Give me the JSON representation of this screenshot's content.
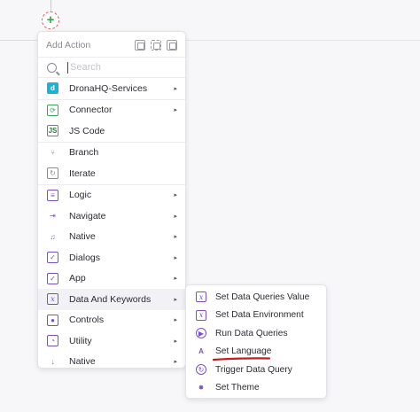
{
  "menu": {
    "title": "Add Action",
    "header_icons": [
      "expand-icon",
      "focus-icon",
      "image-icon"
    ],
    "search": {
      "placeholder": "Search",
      "value": ""
    },
    "groups": [
      {
        "items": [
          {
            "label": "DronaHQ-Services",
            "icon": "dronahq-logo-icon",
            "has_submenu": true
          }
        ]
      },
      {
        "items": [
          {
            "label": "Connector",
            "icon": "connector-icon",
            "has_submenu": true
          },
          {
            "label": "JS Code",
            "icon": "js-icon",
            "has_submenu": false
          }
        ]
      },
      {
        "items": [
          {
            "label": "Branch",
            "icon": "branch-icon",
            "has_submenu": false
          },
          {
            "label": "Iterate",
            "icon": "iterate-icon",
            "has_submenu": false
          }
        ]
      },
      {
        "items": [
          {
            "label": "Logic",
            "icon": "logic-icon",
            "has_submenu": true
          },
          {
            "label": "Navigate",
            "icon": "navigate-icon",
            "has_submenu": true
          },
          {
            "label": "Native",
            "icon": "bell-icon",
            "has_submenu": true
          },
          {
            "label": "Dialogs",
            "icon": "check-circle-icon",
            "has_submenu": true
          },
          {
            "label": "App",
            "icon": "app-icon",
            "has_submenu": true
          },
          {
            "label": "Data And Keywords",
            "icon": "variable-icon",
            "has_submenu": true,
            "active": true
          },
          {
            "label": "Controls",
            "icon": "eye-icon",
            "has_submenu": true
          },
          {
            "label": "Utility",
            "icon": "utility-icon",
            "has_submenu": true
          },
          {
            "label": "Native",
            "icon": "download-arrow-icon",
            "has_submenu": true
          }
        ]
      }
    ]
  },
  "submenu": {
    "items": [
      {
        "label": "Set Data Queries Value",
        "icon": "variable-icon"
      },
      {
        "label": "Set Data Environment",
        "icon": "variable-icon"
      },
      {
        "label": "Run Data Queries",
        "icon": "run-query-icon"
      },
      {
        "label": "Set Language",
        "icon": "translate-icon"
      },
      {
        "label": "Trigger Data Query",
        "icon": "trigger-query-icon"
      },
      {
        "label": "Set Theme",
        "icon": "theme-icon"
      }
    ]
  },
  "colors": {
    "accent_purple": "#7a4fc9",
    "accent_green": "#3aa655",
    "drona_blue": "#19b5d8",
    "annotation_red": "#c41e1e"
  }
}
